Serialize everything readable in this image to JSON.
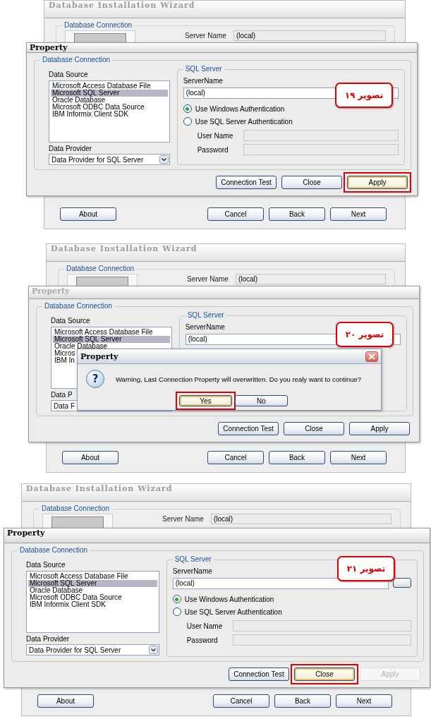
{
  "panels": [
    {
      "wizard": {
        "title": "Database Installation Wizard",
        "group_title": "Database Connection",
        "server_label": "Server Name",
        "server_value": "(local)",
        "buttons": [
          "About",
          "Cancel",
          "Back",
          "Next"
        ]
      },
      "dialog": {
        "title": "Property",
        "active": true,
        "group_title": "Database Connection",
        "data_source_label": "Data Source",
        "data_sources": [
          {
            "label": "Microsoft Access Database File",
            "selected": false
          },
          {
            "label": "Microsoft SQL Server",
            "selected": true
          },
          {
            "label": "Oracle Database",
            "selected": false
          },
          {
            "label": "Microsoft ODBC Data Source",
            "selected": false
          },
          {
            "label": "IBM Informix Client SDK",
            "selected": false
          }
        ],
        "data_provider_label": "Data Provider",
        "data_provider": "Data Provider for SQL Server",
        "dropdown_arrow": true,
        "sql_group_title": "SQL Server",
        "server_name_label": "ServerName",
        "server_name": "(local)",
        "has_browse_button": false,
        "auth_options": [
          {
            "label": "Use Windows Authentication",
            "selected": true
          },
          {
            "label": "Use SQL Server Authentication",
            "selected": false
          }
        ],
        "user_name_label": "User Name",
        "password_label": "Password",
        "buttons": [
          {
            "label": "Connection Test",
            "highlighted": false,
            "disabled": false
          },
          {
            "label": "Close",
            "highlighted": false,
            "disabled": false
          },
          {
            "label": "Apply",
            "highlighted": true,
            "disabled": false
          }
        ]
      },
      "annotation": "تصویر ۱۹"
    },
    {
      "wizard": {
        "title": "Database Installation Wizard",
        "group_title": "Database Connection",
        "server_label": "Server Name",
        "server_value": "(local)",
        "buttons": [
          "About",
          "Cancel",
          "Back",
          "Next"
        ]
      },
      "dialog": {
        "title": "Property",
        "active": false,
        "group_title": "Database Connection",
        "data_source_label": "Data Source",
        "data_sources": [
          {
            "label": "Microsoft Access Database File",
            "selected": false
          },
          {
            "label": "Microsoft SQL Server",
            "selected": true
          },
          {
            "label": "Oracle Database",
            "selected": false
          },
          {
            "label": "Micros",
            "selected": false
          },
          {
            "label": "IBM In",
            "selected": false
          }
        ],
        "data_provider_label": "Data P",
        "data_provider": "Data F",
        "dropdown_arrow": false,
        "sql_group_title": "SQL Server",
        "server_name_label": "ServerName",
        "server_name": "(local)",
        "has_browse_button": false,
        "buttons": [
          {
            "label": "Connection Test",
            "highlighted": false,
            "disabled": false
          },
          {
            "label": "Close",
            "highlighted": false,
            "disabled": false
          },
          {
            "label": "Apply",
            "highlighted": false,
            "disabled": false
          }
        ]
      },
      "message_box": {
        "title": "Property",
        "icon": "?",
        "message": "Warning, Last Connection Property will overwritten. Do you realy want to continue?",
        "buttons": [
          {
            "label": "Yes",
            "highlighted": true
          },
          {
            "label": "No",
            "highlighted": false
          }
        ]
      },
      "annotation": "تصویر ۲۰"
    },
    {
      "wizard": {
        "title": "Database Installation Wizard",
        "group_title": "Database Connection",
        "server_label": "Server Name",
        "server_value": "(local)",
        "buttons": [
          "About",
          "Cancel",
          "Back",
          "Next"
        ]
      },
      "dialog": {
        "title": "Property",
        "active": true,
        "group_title": "Database Connection",
        "data_source_label": "Data Source",
        "data_sources": [
          {
            "label": "Microsoft Access Database File",
            "selected": false
          },
          {
            "label": "Microsoft SQL Server",
            "selected": true
          },
          {
            "label": "Oracle Database",
            "selected": false
          },
          {
            "label": "Microsoft ODBC Data Source",
            "selected": false
          },
          {
            "label": "IBM Informix Client SDK",
            "selected": false
          }
        ],
        "data_provider_label": "Data Provider",
        "data_provider": "Data Provider for SQL Server",
        "dropdown_arrow": true,
        "sql_group_title": "SQL Server",
        "server_name_label": "ServerName",
        "server_name": "(local)",
        "has_browse_button": true,
        "auth_options": [
          {
            "label": "Use Windows Authentication",
            "selected": true
          },
          {
            "label": "Use SQL Server Authentication",
            "selected": false
          }
        ],
        "user_name_label": "User Name",
        "password_label": "Password",
        "buttons": [
          {
            "label": "Connection Test",
            "highlighted": false,
            "disabled": false
          },
          {
            "label": "Close",
            "highlighted": true,
            "disabled": false
          },
          {
            "label": "Apply",
            "highlighted": false,
            "disabled": true
          }
        ]
      },
      "annotation": "تصویر ۲۱"
    }
  ]
}
